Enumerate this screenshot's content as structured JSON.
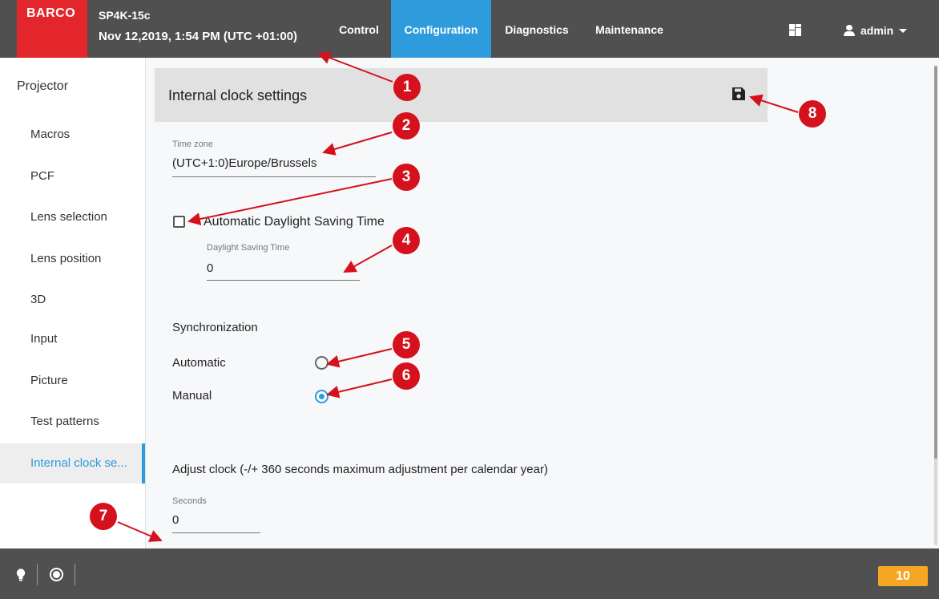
{
  "header": {
    "brand": "BARCO",
    "device_name": "SP4K-15c",
    "datetime": "Nov 12,2019, 1:54 PM (UTC +01:00)",
    "tabs": [
      {
        "label": "Control"
      },
      {
        "label": "Configuration"
      },
      {
        "label": "Diagnostics"
      },
      {
        "label": "Maintenance"
      }
    ],
    "active_tab": "Configuration",
    "layout_icon": "dashboard-icon",
    "user": "admin"
  },
  "sidebar": {
    "title": "Projector",
    "items": [
      {
        "label": "Macros"
      },
      {
        "label": "PCF"
      },
      {
        "label": "Lens selection"
      },
      {
        "label": "Lens position"
      },
      {
        "label": "3D"
      },
      {
        "label": "Input"
      },
      {
        "label": "Picture"
      },
      {
        "label": "Test patterns"
      },
      {
        "label": "Internal clock se..."
      }
    ],
    "active_item": "Internal clock se..."
  },
  "main": {
    "section_title": "Internal clock settings",
    "save_icon": "floppy-disk-icon",
    "timezone": {
      "label": "Time zone",
      "value": "(UTC+1:0)Europe/Brussels"
    },
    "auto_dst": {
      "label": "Automatic Daylight Saving Time",
      "checked": false
    },
    "dst": {
      "label": "Daylight Saving Time",
      "value": "0"
    },
    "sync": {
      "heading": "Synchronization",
      "options": [
        {
          "label": "Automatic",
          "selected": false
        },
        {
          "label": "Manual",
          "selected": true
        }
      ]
    },
    "adjust": {
      "heading": "Adjust clock (-/+ 360 seconds maximum adjustment per calendar year)",
      "seconds_label": "Seconds",
      "seconds_value": "0"
    }
  },
  "footer": {
    "lamp_icon": "lightbulb-icon",
    "shutter_icon": "shutter-icon",
    "notifications": "10"
  },
  "callouts": [
    "1",
    "2",
    "3",
    "4",
    "5",
    "6",
    "7",
    "8"
  ],
  "colors": {
    "accent": "#2d9bdc",
    "brand_red": "#e3262b",
    "callout_red": "#d4111c",
    "badge_orange": "#f6a623",
    "bar_gray": "#505050"
  }
}
